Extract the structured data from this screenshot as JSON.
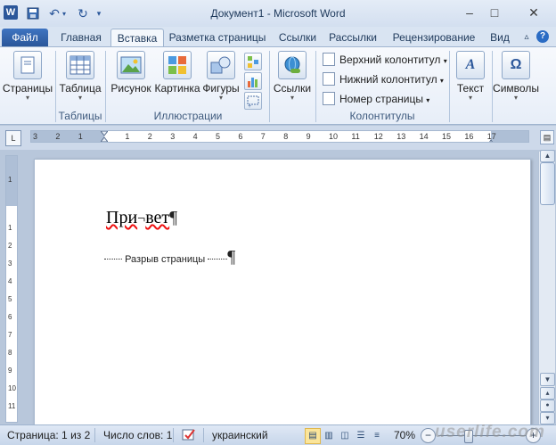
{
  "window": {
    "title": "Документ1 - Microsoft Word",
    "app_icon": "word-icon",
    "controls": {
      "minimize": "–",
      "maximize": "□",
      "close": "✕"
    }
  },
  "quick_access": {
    "app_letter": "W",
    "undo": "↶",
    "redo": "↻",
    "customize": "▾"
  },
  "tabs": [
    {
      "label": "Файл"
    },
    {
      "label": "Главная"
    },
    {
      "label": "Вставка"
    },
    {
      "label": "Разметка страницы"
    },
    {
      "label": "Ссылки"
    },
    {
      "label": "Рассылки"
    },
    {
      "label": "Рецензирование"
    },
    {
      "label": "Вид"
    }
  ],
  "ribbon_controls": {
    "collapse": "▵",
    "help": "?"
  },
  "ribbon": {
    "pages": {
      "label": "Страницы"
    },
    "tables_group": {
      "button": "Таблица",
      "label": "Таблицы"
    },
    "illustrations_group": {
      "picture": "Рисунок",
      "clipart": "Картинка",
      "shapes": "Фигуры",
      "label": "Иллюстрации"
    },
    "links": {
      "label": "Ссылки"
    },
    "header_footer_group": {
      "header": "Верхний колонтитул",
      "footer": "Нижний колонтитул",
      "page_number": "Номер страницы",
      "label": "Колонтитулы"
    },
    "text": {
      "label": "Текст"
    },
    "symbols": {
      "label": "Символы"
    }
  },
  "ruler": {
    "tab_selector": "L",
    "h_numbers": [
      "3",
      "2",
      "1",
      "1",
      "2",
      "3",
      "4",
      "5",
      "6",
      "7",
      "8",
      "9",
      "10",
      "11",
      "12",
      "13",
      "14",
      "15",
      "16",
      "17"
    ],
    "v_numbers": [
      "1",
      "1",
      "2",
      "3",
      "4",
      "5",
      "6",
      "7",
      "8",
      "9",
      "10",
      "11"
    ]
  },
  "document": {
    "line1_part1": "При",
    "line1_hyphen": "¬",
    "line1_part2": "вет",
    "pilcrow": "¶",
    "page_break": "Разрыв страницы"
  },
  "statusbar": {
    "page": "Страница: 1 из 2",
    "words": "Число слов: 1",
    "language": "украинский",
    "zoom": "70%",
    "zoom_level": 0.7
  },
  "watermark": "userlife.com"
}
